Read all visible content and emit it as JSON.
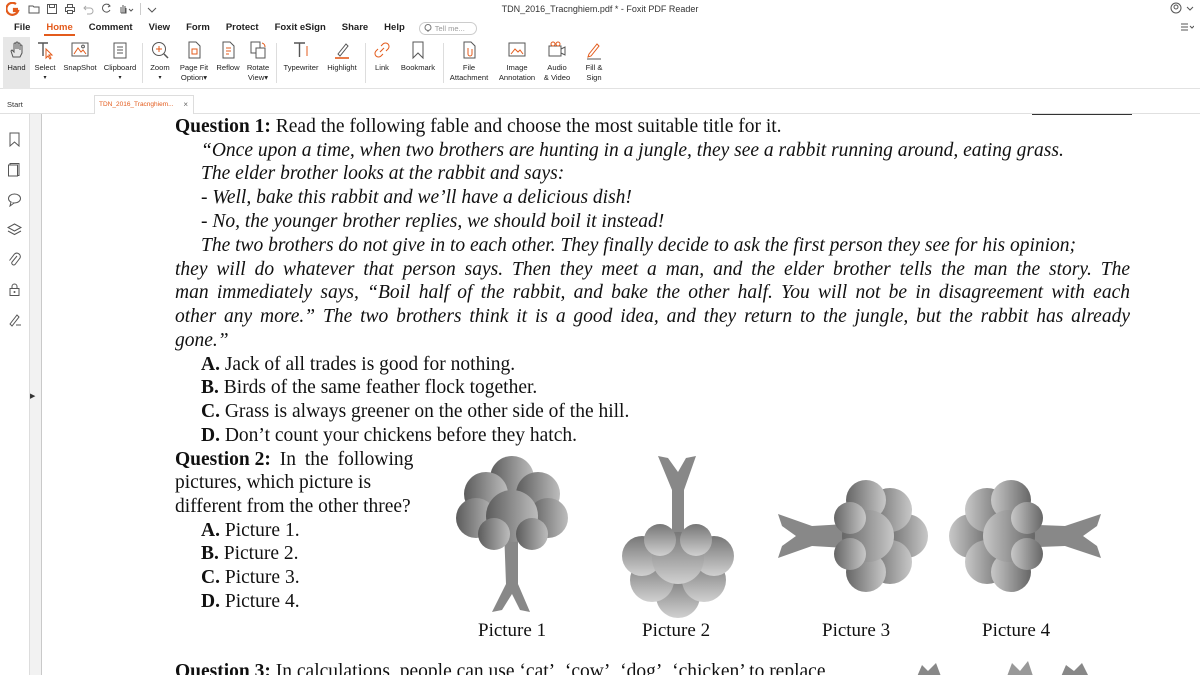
{
  "titlebar": {
    "title": "TDN_2016_Tracnghiem.pdf * - Foxit PDF Reader"
  },
  "menu": {
    "items": [
      "File",
      "Home",
      "Comment",
      "View",
      "Form",
      "Protect",
      "Foxit eSign",
      "Share",
      "Help"
    ],
    "active": "Home",
    "tellme_placeholder": "Tell me..."
  },
  "ribbon": {
    "hand": "Hand",
    "select": "Select",
    "snapshot": "SnapShot",
    "clipboard": "Clipboard",
    "zoom": "Zoom",
    "pagefit_1": "Page Fit",
    "pagefit_2": "Option",
    "reflow": "Reflow",
    "rotate_1": "Rotate",
    "rotate_2": "View",
    "typewriter": "Typewriter",
    "highlight": "Highlight",
    "link": "Link",
    "bookmark": "Bookmark",
    "file_1": "File",
    "file_2": "Attachment",
    "image_1": "Image",
    "image_2": "Annotation",
    "audio_1": "Audio",
    "audio_2": "& Video",
    "fill_1": "Fill &",
    "fill_2": "Sign"
  },
  "tabs": {
    "start": "Start",
    "doc": "TDN_2016_Tracnghiem..."
  },
  "document": {
    "q1_label": "Question 1:",
    "q1_text": " Read the following fable and choose the most suitable title for it.",
    "fable": [
      "“Once upon a time, when two brothers are hunting in a jungle, they see a rabbit running around, eating grass.",
      "The elder brother looks at the rabbit and says:",
      "- Well, bake this rabbit and we’ll have a delicious dish!",
      "- No, the younger brother replies, we should boil it instead!",
      "The two brothers do not give in to each other. They finally decide to ask the first person they see for his opinion;",
      "they will do whatever that person says. Then they meet a man, and the elder brother tells the man the story. The",
      "man immediately says, “Boil half of the rabbit, and bake the other half. You will not be in disagreement with each",
      "other any more.”  The two brothers think it is a good idea, and they return to the jungle, but the rabbit has already",
      "gone.”"
    ],
    "q1_options": [
      {
        "letter": "A.",
        "text": " Jack of all trades is good for nothing."
      },
      {
        "letter": "B.",
        "text": " Birds of the same feather flock together."
      },
      {
        "letter": "C.",
        "text": " Grass is always greener on the other side of the hill."
      },
      {
        "letter": "D.",
        "text": " Don’t count your chickens before they hatch."
      }
    ],
    "q2_label": "Question 2:",
    "q2_lines": [
      " In the following",
      "pictures,   which   picture   is",
      "different from the other three?"
    ],
    "q2_options": [
      {
        "letter": "A.",
        "text": " Picture 1."
      },
      {
        "letter": "B.",
        "text": " Picture 2."
      },
      {
        "letter": "C.",
        "text": " Picture 3."
      },
      {
        "letter": "D.",
        "text": " Picture 4."
      }
    ],
    "pictures": [
      "Picture 1",
      "Picture 2",
      "Picture 3",
      "Picture 4"
    ],
    "q3_label": "Question 3:",
    "q3_text": " In calculations, people can use ‘cat’, ‘cow’, ‘dog’, ‘chicken’ to replace"
  }
}
